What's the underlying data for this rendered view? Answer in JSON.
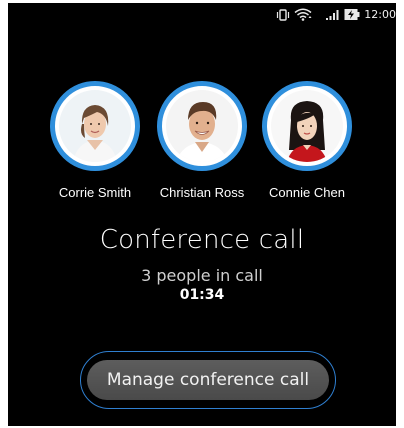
{
  "status_bar": {
    "time": "12:00",
    "icons": [
      "vibrate-icon",
      "wifi-icon",
      "signal-icon",
      "battery-charging-icon"
    ]
  },
  "participants": [
    {
      "name": "Corrie Smith",
      "avatar": "woman-short-hair-photo"
    },
    {
      "name": "Christian Ross",
      "avatar": "man-smiling-photo"
    },
    {
      "name": "Connie Chen",
      "avatar": "woman-long-hair-photo"
    }
  ],
  "call": {
    "title": "Conference call",
    "subtitle": "3 people in call",
    "timer": "01:34"
  },
  "manage_button": {
    "label": "Manage conference call"
  },
  "colors": {
    "background": "#000000",
    "avatar_ring": "#2f8fdc",
    "button_outline": "#2f7fd0",
    "button_fill": "#545454"
  }
}
